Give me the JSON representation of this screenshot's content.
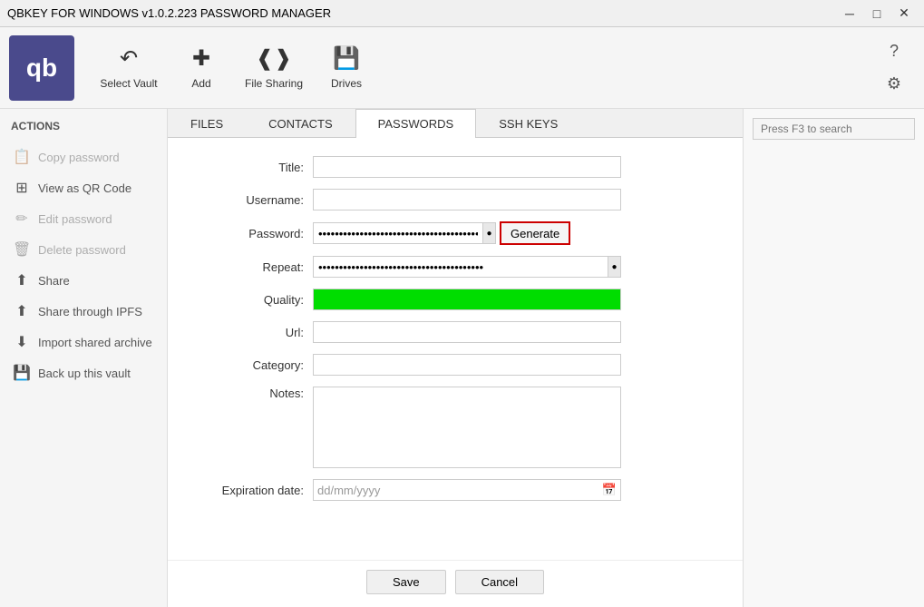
{
  "titlebar": {
    "title": "QBKEY FOR WINDOWS v1.0.2.223   PASSWORD MANAGER",
    "min": "─",
    "max": "□",
    "close": "✕"
  },
  "toolbar": {
    "logo_text": "qb",
    "select_vault_label": "Select Vault",
    "add_label": "Add",
    "file_sharing_label": "File Sharing",
    "drives_label": "Drives",
    "help_icon": "?",
    "settings_icon": "⚙"
  },
  "tabs": [
    {
      "label": "FILES",
      "active": false
    },
    {
      "label": "CONTACTS",
      "active": false
    },
    {
      "label": "PASSWORDS",
      "active": true
    },
    {
      "label": "SSH KEYS",
      "active": false
    }
  ],
  "sidebar": {
    "title": "ACTIONS",
    "items": [
      {
        "label": "Copy password",
        "icon": "📋",
        "disabled": true
      },
      {
        "label": "View as QR Code",
        "icon": "⊞",
        "disabled": false
      },
      {
        "label": "Edit password",
        "icon": "✏",
        "disabled": true
      },
      {
        "label": "Delete password",
        "icon": "🗑",
        "disabled": true
      },
      {
        "label": "Share",
        "icon": "⬆",
        "disabled": false
      },
      {
        "label": "Share through IPFS",
        "icon": "⬆",
        "disabled": false
      },
      {
        "label": "Import shared archive",
        "icon": "⬇",
        "disabled": false
      },
      {
        "label": "Back up this vault",
        "icon": "💾",
        "disabled": false
      }
    ]
  },
  "form": {
    "title_label": "Title:",
    "username_label": "Username:",
    "password_label": "Password:",
    "repeat_label": "Repeat:",
    "quality_label": "Quality:",
    "url_label": "Url:",
    "category_label": "Category:",
    "notes_label": "Notes:",
    "expiration_label": "Expiration date:",
    "generate_btn": "Generate",
    "password_dots": "••••••••••••••••••••••••••••••••••••••••",
    "repeat_dots": "••••••••••••••••••••••••••••••••••••••••",
    "date_placeholder": "dd/mm/yyyy",
    "quality_percent": 100
  },
  "footer": {
    "save_label": "Save",
    "cancel_label": "Cancel"
  },
  "search": {
    "placeholder": "Press F3 to search"
  }
}
